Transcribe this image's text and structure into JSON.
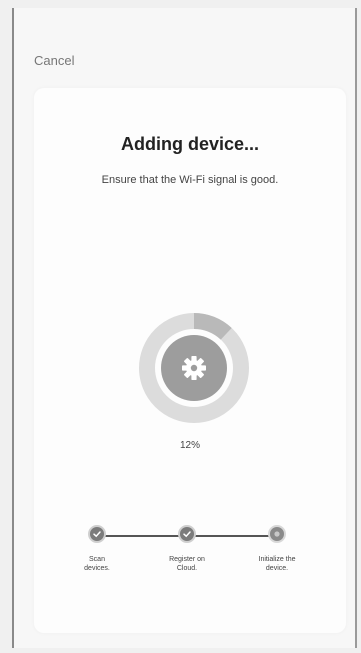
{
  "header": {
    "cancel_label": "Cancel"
  },
  "main": {
    "title": "Adding device...",
    "subtitle": "Ensure that the Wi-Fi signal is good.",
    "progress": {
      "percent_text": "12%",
      "value": 0.12,
      "icon": "gear-icon"
    },
    "steps": [
      {
        "label": "Scan\ndevices.",
        "status": "done",
        "icon": "check-icon"
      },
      {
        "label": "Register on\nCloud.",
        "status": "done",
        "icon": "check-icon"
      },
      {
        "label": "Initialize the\ndevice.",
        "status": "pending",
        "icon": "dot-icon"
      }
    ]
  },
  "colors": {
    "ring_track": "#dcdcdc",
    "ring_progress": "#b9b9b9",
    "inner_circle": "#9d9d9d",
    "step_line": "#555555"
  }
}
